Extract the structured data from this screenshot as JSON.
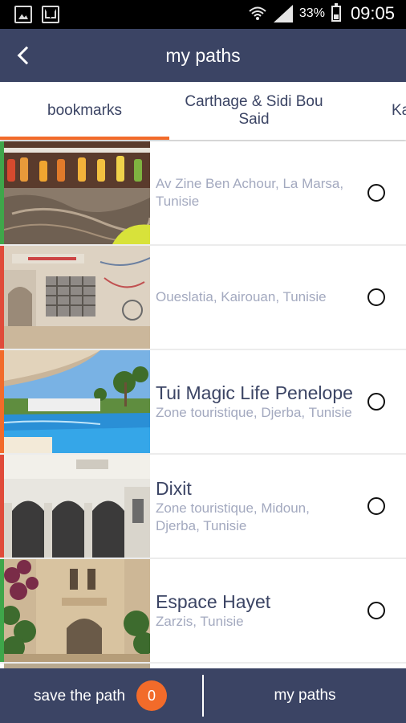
{
  "status_bar": {
    "icons": [
      "gallery-icon",
      "mail-icon",
      "wifi-icon",
      "signal-icon",
      "battery-icon"
    ],
    "battery": "33%",
    "time": "09:05"
  },
  "app_bar": {
    "back_icon": "chevron-left-icon",
    "title": "my paths"
  },
  "tabs": [
    {
      "label": "bookmarks",
      "selected": true
    },
    {
      "label": "Carthage & Sidi Bou Said",
      "selected": false
    },
    {
      "label": "Ka",
      "selected": false
    }
  ],
  "list": {
    "items": [
      {
        "name": "",
        "address": "Av Zine Ben Achour,  La Marsa, Tunisie",
        "accent_color": "#3fa64a",
        "selected": false
      },
      {
        "name": "",
        "address": "Oueslatia, Kairouan, Tunisie",
        "accent_color": "#e04b3a",
        "selected": false
      },
      {
        "name": "Tui Magic Life Penelope",
        "address": "Zone touristique, Djerba, Tunisie",
        "accent_color": "#f26b2a",
        "selected": false
      },
      {
        "name": "Dixit",
        "address": "Zone touristique, Midoun, Djerba, Tunisie",
        "accent_color": "#e04b3a",
        "selected": false
      },
      {
        "name": "Espace Hayet",
        "address": "Zarzis, Tunisie",
        "accent_color": "#3fa64a",
        "selected": false
      }
    ]
  },
  "bottom_bar": {
    "save_label": "save the path",
    "save_count": "0",
    "my_paths_label": "my paths"
  },
  "colors": {
    "primary": "#3b4464",
    "accent": "#f26b2a",
    "subtitle": "#a3a9bf"
  }
}
